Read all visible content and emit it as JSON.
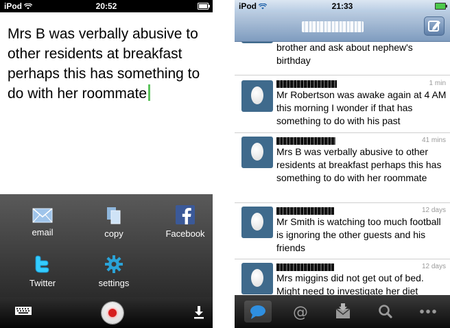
{
  "left_phone": {
    "status": {
      "carrier": "iPod",
      "time": "20:52"
    },
    "note_text": "Mrs B was verbally abusive to other residents at breakfast perhaps this has something to do with her roommate",
    "share": [
      {
        "label": "email",
        "icon": "envelope-icon"
      },
      {
        "label": "copy",
        "icon": "copy-icon"
      },
      {
        "label": "Facebook",
        "icon": "facebook-icon"
      },
      {
        "label": "Twitter",
        "icon": "twitter-icon"
      },
      {
        "label": "settings",
        "icon": "gear-icon"
      }
    ],
    "toolbar": {
      "keyboard_icon": "keyboard-icon",
      "record_icon": "record-icon",
      "download_icon": "download-icon"
    },
    "colors": {
      "cursor": "#5cc35c",
      "record": "#d61e1e",
      "twitter_blue": "#1da1f2",
      "facebook_blue": "#3b5998"
    }
  },
  "right_phone": {
    "status": {
      "carrier": "iPod",
      "time": "21:33"
    },
    "compose_icon": "compose-icon",
    "tweets": [
      {
        "time": "",
        "text_top": "brother and ask about nephew's birthday"
      },
      {
        "time": "1 min",
        "text": "Mr Robertson was awake again at 4 AM this morning I wonder if that has something to do with his past"
      },
      {
        "time": "41 mins",
        "text": "Mrs B was verbally abusive to other residents at breakfast perhaps this has something to do with her roommate"
      },
      {
        "time": "12 days",
        "text": "Mr Smith is watching too much football is ignoring the other guests and his friends"
      },
      {
        "time": "12 days",
        "text": "Mrs miggins did not get out of bed. Might need to investigate her diet"
      }
    ],
    "tabs": [
      "timeline-icon",
      "mentions-icon",
      "messages-icon",
      "search-icon",
      "more-icon"
    ],
    "colors": {
      "avatar": "#3f6a8c",
      "navbar": "#8aa6c8"
    }
  }
}
